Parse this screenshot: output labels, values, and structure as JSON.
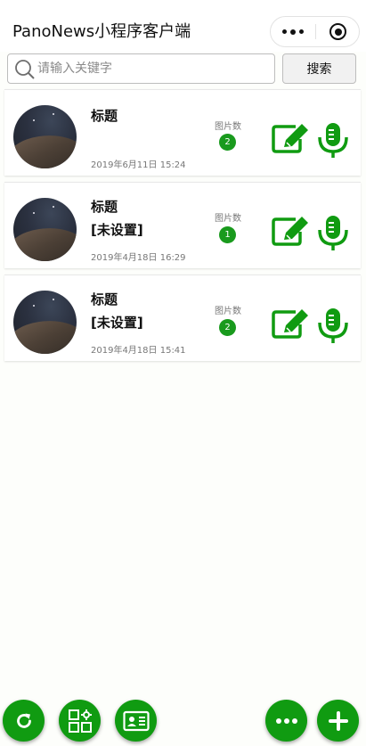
{
  "header": {
    "title": "PanoNews小程序客户端",
    "more_icon": "more-dots-icon",
    "close_icon": "target-circle-icon"
  },
  "search": {
    "placeholder": "请输入关键字",
    "value": "",
    "button_label": "搜索"
  },
  "colors": {
    "accent": "#109b11",
    "badge": "#199a1d",
    "card_bg": "#ffffff",
    "page_bg": "#fdfefb"
  },
  "items": [
    {
      "title": "标题",
      "subtitle": "",
      "date": "2019年6月11日 15:24",
      "count_label": "图片数",
      "count": "2"
    },
    {
      "title": "标题",
      "subtitle": "[未设置]",
      "date": "2019年4月18日 16:29",
      "count_label": "图片数",
      "count": "1"
    },
    {
      "title": "标题",
      "subtitle": "[未设置]",
      "date": "2019年4月18日 15:41",
      "count_label": "图片数",
      "count": "2"
    }
  ],
  "fabs": [
    {
      "icon": "refresh-icon"
    },
    {
      "icon": "grid-apps-icon"
    },
    {
      "icon": "id-card-icon"
    },
    {
      "icon": "more-dots-icon"
    },
    {
      "icon": "plus-icon"
    }
  ]
}
